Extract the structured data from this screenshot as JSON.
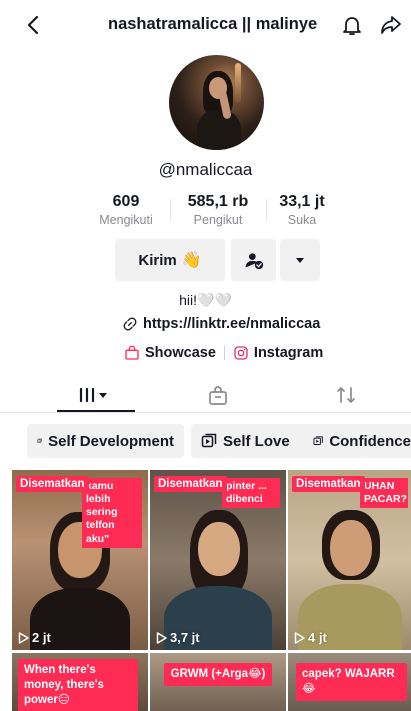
{
  "header": {
    "title": "nashatramalicca || malinye"
  },
  "profile": {
    "username": "@nmaliccaa",
    "stats": [
      {
        "value": "609",
        "label": "Mengikuti"
      },
      {
        "value": "585,1 rb",
        "label": "Pengikut"
      },
      {
        "value": "33,1 jt",
        "label": "Suka"
      }
    ],
    "buttons": {
      "message": "Kirim",
      "message_emoji": "👋"
    },
    "bio": "hii!🤍🤍",
    "link": "https://linktr.ee/nmaliccaa",
    "social": {
      "showcase": "Showcase",
      "instagram": "Instagram"
    }
  },
  "playlists": [
    {
      "label": "Self Development"
    },
    {
      "label": "Self Love"
    },
    {
      "label": "Confidence"
    }
  ],
  "videos": [
    {
      "pinned_label": "Disematkan",
      "caption": "kamu lebih sering telfon aku\"",
      "views": "2 jt"
    },
    {
      "pinned_label": "Disematkan",
      "caption": "pinter ... dibenci",
      "views": "3,7 jt"
    },
    {
      "pinned_label": "Disematkan",
      "caption": "UHAN PACAR?",
      "views": "4 jt"
    },
    {
      "caption": "When there's money, there's power😑"
    },
    {
      "caption": "GRWM (+Arga😂)"
    },
    {
      "caption": "capek? WAJARR😂"
    }
  ],
  "colors": {
    "accent": "#fe2c55",
    "text": "#161823",
    "muted": "#8a8b91",
    "button_bg": "#f1f1f2"
  },
  "icons": {
    "back": "chevron-left-icon",
    "notification": "bell-icon",
    "share": "share-arrow-icon",
    "add_friend": "person-check-icon",
    "more": "caret-down-icon",
    "link": "link-icon",
    "showcase": "shopping-bag-icon",
    "instagram": "instagram-icon",
    "videos_tab": "grid-icon",
    "shop_tab": "bag-icon",
    "repost_tab": "repost-icon",
    "playlist": "playlist-icon",
    "views": "play-icon"
  }
}
